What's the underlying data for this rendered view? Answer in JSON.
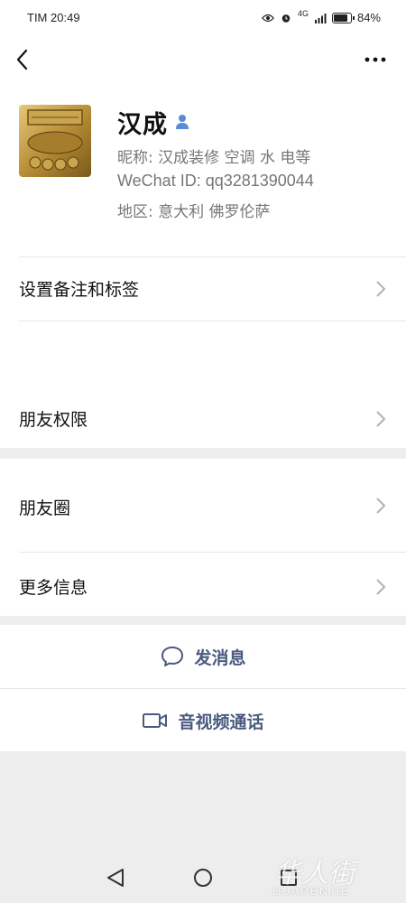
{
  "status_bar": {
    "carrier": "TIM",
    "time": "20:49",
    "network": "4G",
    "battery": "84%"
  },
  "profile": {
    "name": "汉成",
    "nickname": "昵称: 汉成装修 空调 水 电等",
    "wechat_id": "WeChat ID:  qq3281390044",
    "region": "地区: 意大利  佛罗伦萨"
  },
  "rows": {
    "remark_tags": "设置备注和标签",
    "friend_permissions": "朋友权限",
    "moments": "朋友圈",
    "more_info": "更多信息"
  },
  "actions": {
    "send_message": "发消息",
    "video_call": "音视频通话"
  },
  "watermark": {
    "chinese": "华人街",
    "latin": "HUARENJIE"
  },
  "colors": {
    "accent": "#4a5b80",
    "background": "#ededed",
    "gender_male": "#5b8bd6"
  },
  "icons": [
    "back-chevron-icon",
    "more-dots-icon",
    "male-icon",
    "chevron-right-icon",
    "chat-bubble-icon",
    "video-camera-icon"
  ]
}
